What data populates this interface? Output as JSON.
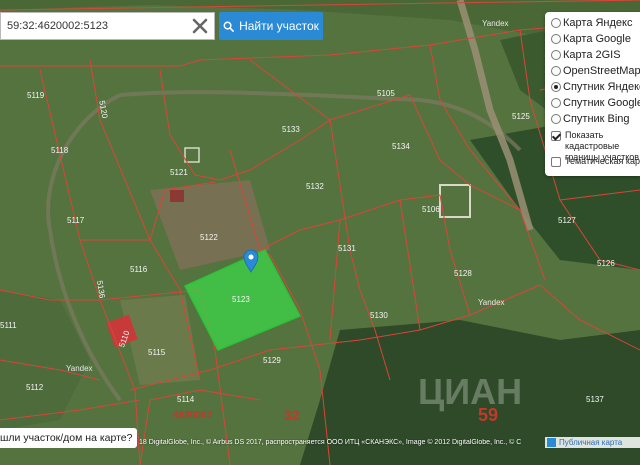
{
  "search": {
    "value": "59:32:4620002:5123",
    "button_label": "Найти участок"
  },
  "layers": {
    "base": [
      {
        "label": "Карта Яндекс",
        "selected": false
      },
      {
        "label": "Карта Google",
        "selected": false
      },
      {
        "label": "Карта 2GIS",
        "selected": false
      },
      {
        "label": "OpenStreetMap",
        "selected": false
      },
      {
        "label": "Спутник Яндекс",
        "selected": true
      },
      {
        "label": "Спутник Google",
        "selected": false
      },
      {
        "label": "Спутник Bing",
        "selected": false
      }
    ],
    "overlays": [
      {
        "label": "Показать кадастровые границы участков",
        "checked": true
      },
      {
        "label": "Тематическая карта",
        "checked": false
      }
    ]
  },
  "map": {
    "selected_plot": "5123",
    "plot_labels": [
      "5119",
      "5120",
      "5118",
      "5121",
      "5133",
      "5105",
      "5125",
      "5134",
      "5132",
      "5117",
      "5122",
      "5106",
      "5116",
      "5131",
      "5127",
      "5126",
      "5128",
      "5130",
      "5110",
      "5115",
      "5129",
      "5114",
      "5112",
      "5111",
      "5136",
      "5137"
    ],
    "quarter_labels": [
      "4620002",
      "32",
      "59"
    ],
    "provider_marks": [
      "Yandex",
      "Yandex",
      "Yandex"
    ],
    "watermark": "ЦИАН",
    "colors": {
      "boundary": "#d9453a",
      "selected_fill": "#3cd648",
      "marker": "#2b8ad6"
    }
  },
  "footer": {
    "report_label": "шли участок/дом на карте?",
    "copyright": "18 DigitalGlobe, Inc., © Airbus DS 2017, распространяется ООО ИТЦ «СКАНЭКС», Image © 2012 DigitalGlobe, Inc., © C",
    "public_map_label": "Публичная карта"
  }
}
